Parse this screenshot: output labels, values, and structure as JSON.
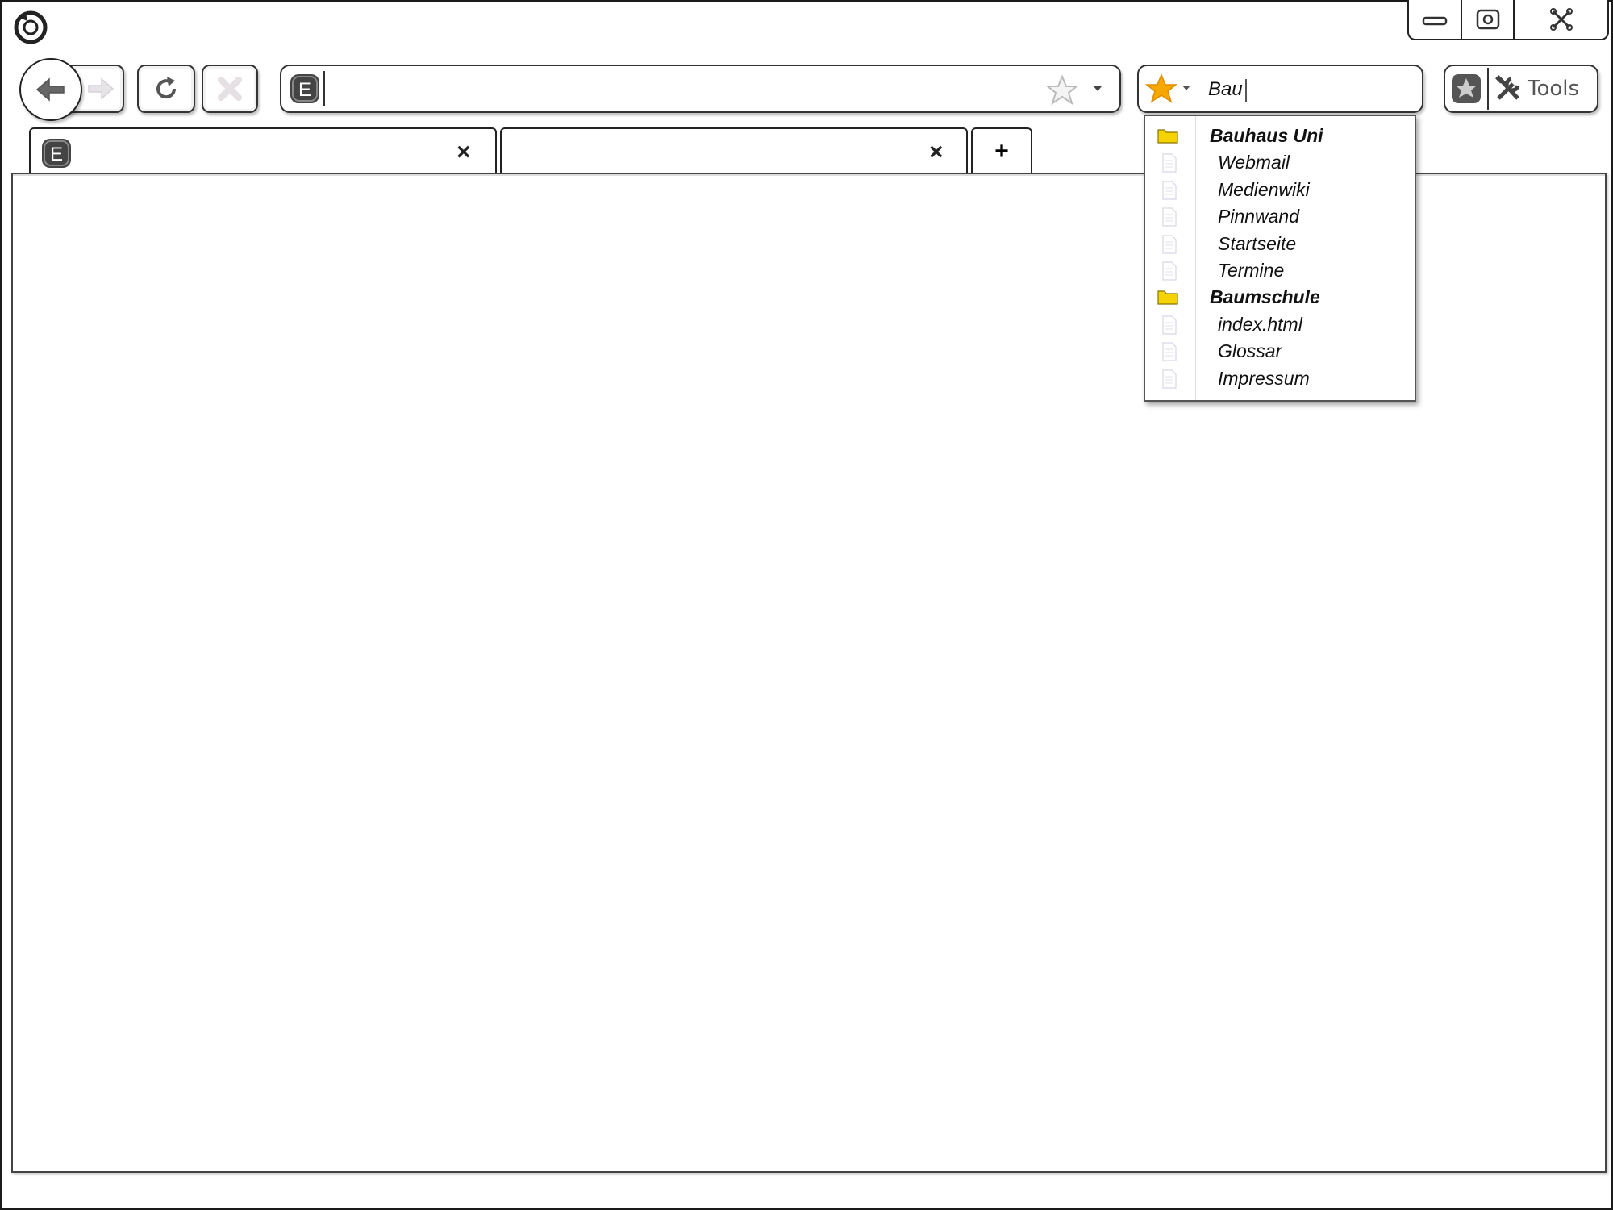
{
  "toolbar": {
    "search_value": "Bau",
    "tools_label": "Tools",
    "site_icon_letter": "E"
  },
  "tabs": [
    {
      "icon_letter": "E",
      "close": "×"
    },
    {
      "close": "×"
    }
  ],
  "new_tab_label": "+",
  "bookmark_dropdown": [
    {
      "type": "folder",
      "label": "Bauhaus Uni"
    },
    {
      "type": "item",
      "label": "Webmail"
    },
    {
      "type": "item",
      "label": "Medienwiki"
    },
    {
      "type": "item",
      "label": "Pinnwand"
    },
    {
      "type": "item",
      "label": "Startseite"
    },
    {
      "type": "item",
      "label": "Termine"
    },
    {
      "type": "folder",
      "label": "Baumschule"
    },
    {
      "type": "item",
      "label": "index.html"
    },
    {
      "type": "item",
      "label": "Glossar"
    },
    {
      "type": "item",
      "label": "Impressum"
    }
  ],
  "colors": {
    "folder": "#f5d300",
    "star": "#f6a800",
    "stroke": "#222222"
  }
}
